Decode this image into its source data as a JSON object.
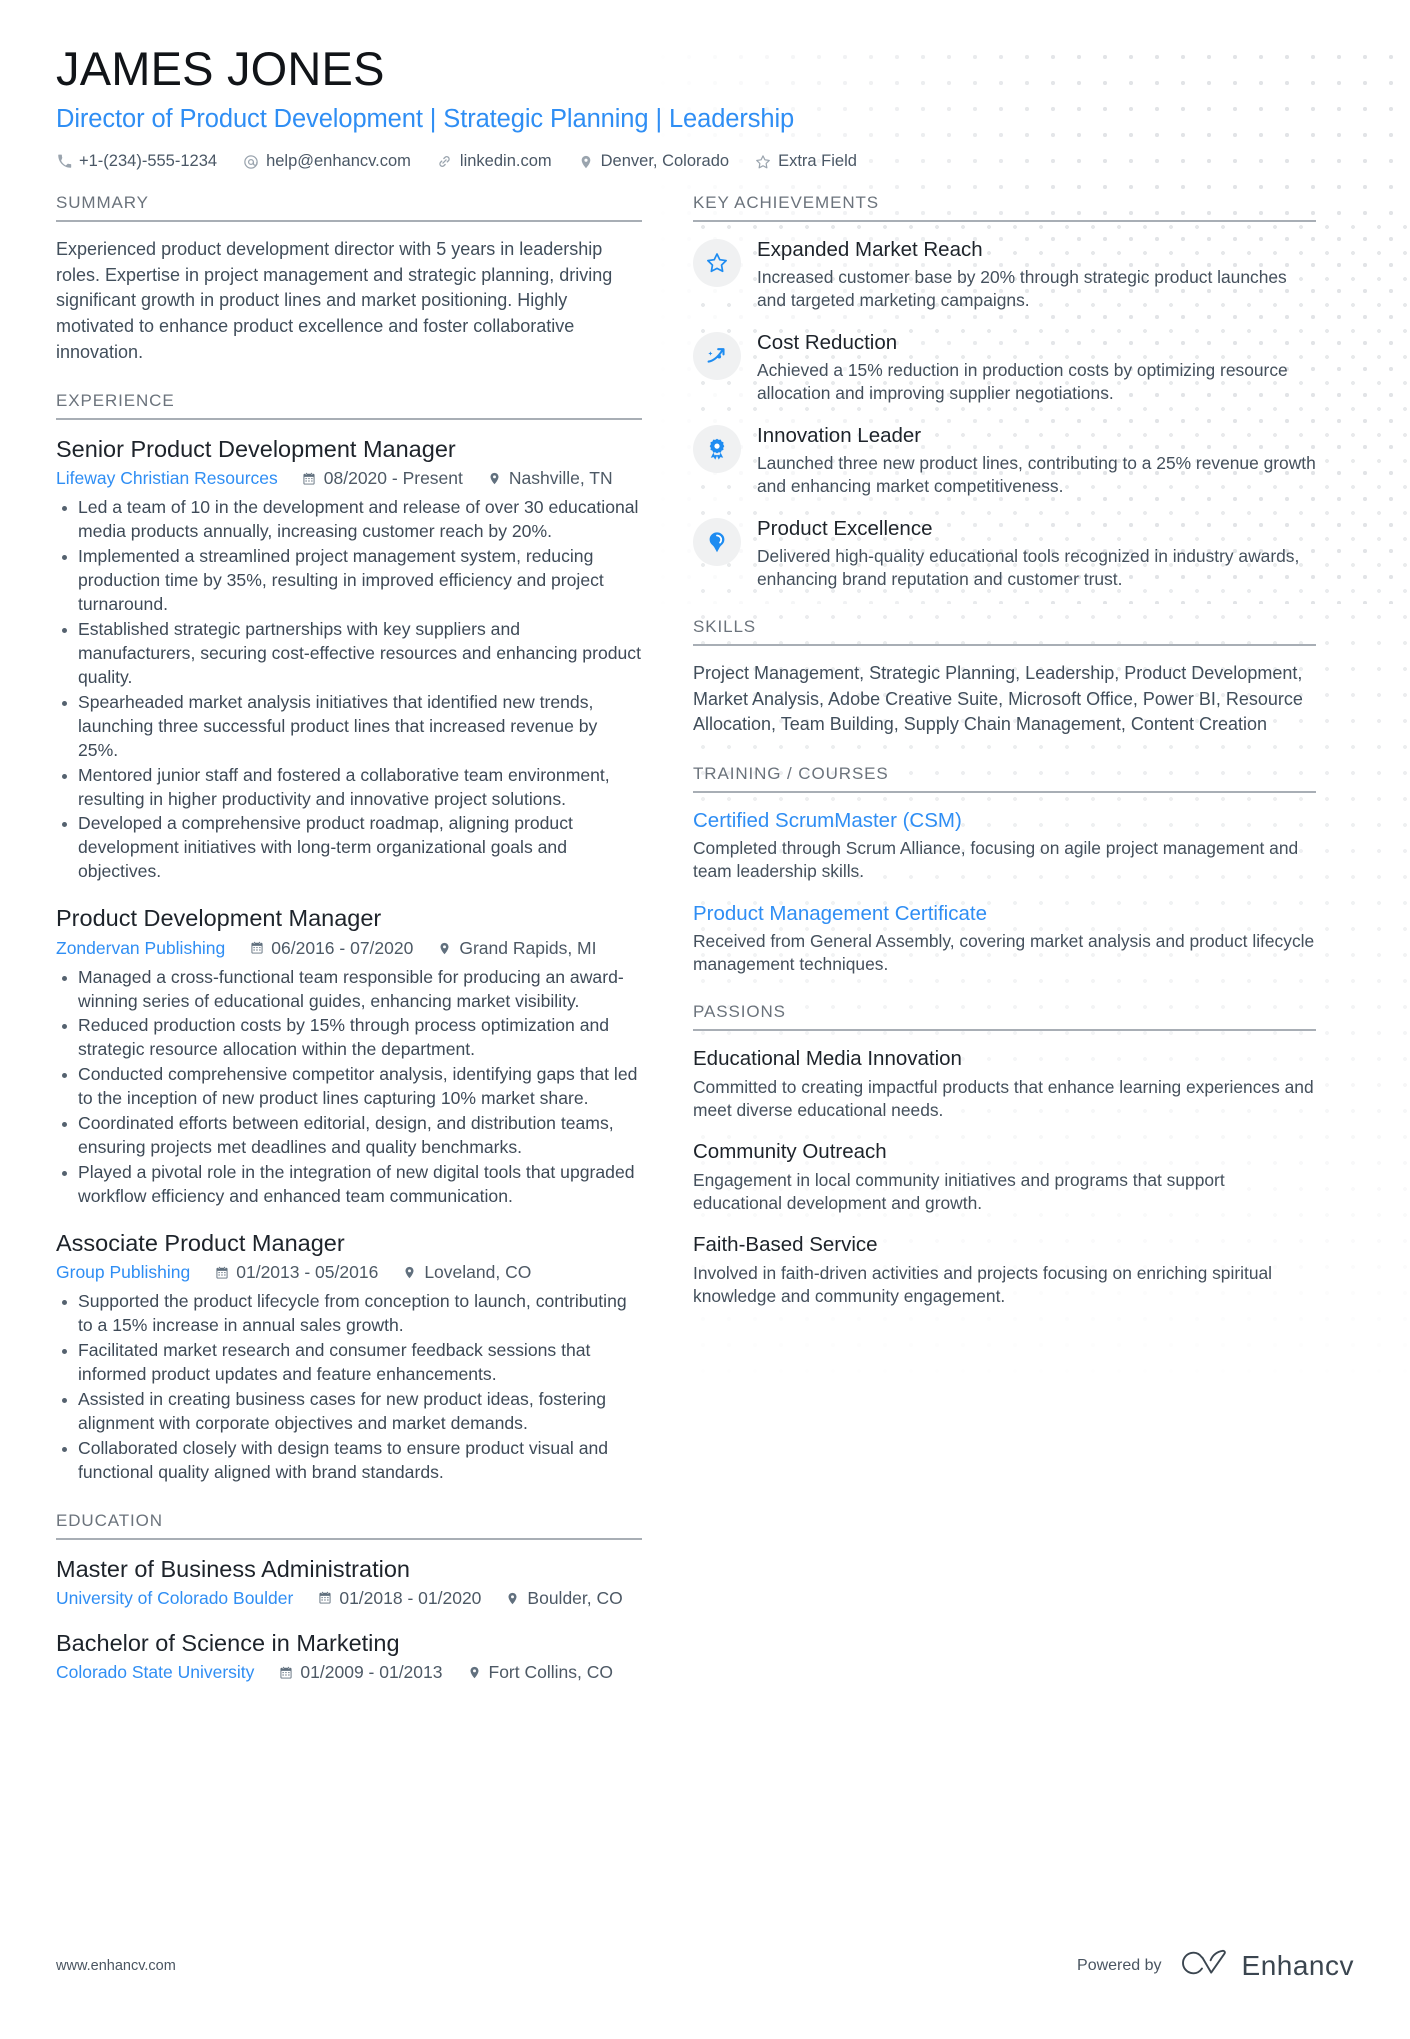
{
  "header": {
    "name": "JAMES JONES",
    "headline": "Director of Product Development | Strategic Planning | Leadership",
    "contacts": [
      {
        "icon": "phone-icon",
        "text": "+1-(234)-555-1234"
      },
      {
        "icon": "email-icon",
        "text": "help@enhancv.com"
      },
      {
        "icon": "link-icon",
        "text": "linkedin.com"
      },
      {
        "icon": "location-pin-icon",
        "text": "Denver, Colorado"
      },
      {
        "icon": "star-outline-icon",
        "text": "Extra Field"
      }
    ]
  },
  "summary": {
    "heading": "SUMMARY",
    "text": "Experienced product development director with 5 years in leadership roles. Expertise in project management and strategic planning, driving significant growth in product lines and market positioning. Highly motivated to enhance product excellence and foster collaborative innovation."
  },
  "experience": {
    "heading": "EXPERIENCE",
    "entries": [
      {
        "title": "Senior Product Development Manager",
        "company": "Lifeway Christian Resources",
        "dates": "08/2020 - Present",
        "location": "Nashville, TN",
        "bullets": [
          "Led a team of 10 in the development and release of over 30 educational media products annually, increasing customer reach by 20%.",
          "Implemented a streamlined project management system, reducing production time by 35%, resulting in improved efficiency and project turnaround.",
          "Established strategic partnerships with key suppliers and manufacturers, securing cost-effective resources and enhancing product quality.",
          "Spearheaded market analysis initiatives that identified new trends, launching three successful product lines that increased revenue by 25%.",
          "Mentored junior staff and fostered a collaborative team environment, resulting in higher productivity and innovative project solutions.",
          "Developed a comprehensive product roadmap, aligning product development initiatives with long-term organizational goals and objectives."
        ]
      },
      {
        "title": "Product Development Manager",
        "company": "Zondervan Publishing",
        "dates": "06/2016 - 07/2020",
        "location": "Grand Rapids, MI",
        "bullets": [
          "Managed a cross-functional team responsible for producing an award-winning series of educational guides, enhancing market visibility.",
          "Reduced production costs by 15% through process optimization and strategic resource allocation within the department.",
          "Conducted comprehensive competitor analysis, identifying gaps that led to the inception of new product lines capturing 10% market share.",
          "Coordinated efforts between editorial, design, and distribution teams, ensuring projects met deadlines and quality benchmarks.",
          "Played a pivotal role in the integration of new digital tools that upgraded workflow efficiency and enhanced team communication."
        ]
      },
      {
        "title": "Associate Product Manager",
        "company": "Group Publishing",
        "dates": "01/2013 - 05/2016",
        "location": "Loveland, CO",
        "bullets": [
          "Supported the product lifecycle from conception to launch, contributing to a 15% increase in annual sales growth.",
          "Facilitated market research and consumer feedback sessions that informed product updates and feature enhancements.",
          "Assisted in creating business cases for new product ideas, fostering alignment with corporate objectives and market demands.",
          "Collaborated closely with design teams to ensure product visual and functional quality aligned with brand standards."
        ]
      }
    ]
  },
  "education": {
    "heading": "EDUCATION",
    "entries": [
      {
        "degree": "Master of Business Administration",
        "school": "University of Colorado Boulder",
        "dates": "01/2018 - 01/2020",
        "location": "Boulder, CO"
      },
      {
        "degree": "Bachelor of Science in Marketing",
        "school": "Colorado State University",
        "dates": "01/2009 - 01/2013",
        "location": "Fort Collins, CO"
      }
    ]
  },
  "key_achievements": {
    "heading": "KEY ACHIEVEMENTS",
    "items": [
      {
        "icon": "star-outline-icon",
        "title": "Expanded Market Reach",
        "desc": "Increased customer base by 20% through strategic product launches and targeted marketing campaigns."
      },
      {
        "icon": "trending-up-icon",
        "title": "Cost Reduction",
        "desc": "Achieved a 15% reduction in production costs by optimizing resource allocation and improving supplier negotiations."
      },
      {
        "icon": "award-medal-icon",
        "title": "Innovation Leader",
        "desc": "Launched three new product lines, contributing to a 25% revenue growth and enhancing market competitiveness."
      },
      {
        "icon": "lightbulb-icon",
        "title": "Product Excellence",
        "desc": "Delivered high-quality educational tools recognized in industry awards, enhancing brand reputation and customer trust."
      }
    ]
  },
  "skills": {
    "heading": "SKILLS",
    "text": "Project Management, Strategic Planning, Leadership, Product Development, Market Analysis, Adobe Creative Suite, Microsoft Office, Power BI, Resource Allocation, Team Building, Supply Chain Management, Content Creation"
  },
  "training": {
    "heading": "TRAINING / COURSES",
    "items": [
      {
        "title": "Certified ScrumMaster (CSM)",
        "desc": "Completed through Scrum Alliance, focusing on agile project management and team leadership skills."
      },
      {
        "title": "Product Management Certificate",
        "desc": "Received from General Assembly, covering market analysis and product lifecycle management techniques."
      }
    ]
  },
  "passions": {
    "heading": "PASSIONS",
    "items": [
      {
        "title": "Educational Media Innovation",
        "desc": "Committed to creating impactful products that enhance learning experiences and meet diverse educational needs."
      },
      {
        "title": "Community Outreach",
        "desc": "Engagement in local community initiatives and programs that support educational development and growth."
      },
      {
        "title": "Faith-Based Service",
        "desc": "Involved in faith-driven activities and projects focusing on enriching spiritual knowledge and community engagement."
      }
    ]
  },
  "footer": {
    "url": "www.enhancv.com",
    "powered_by": "Powered by",
    "brand": "Enhancv"
  },
  "colors": {
    "accent": "#2f8ef4",
    "text": "#3e4a57",
    "heading": "#6b737c",
    "rule": "#a8aeb5"
  }
}
